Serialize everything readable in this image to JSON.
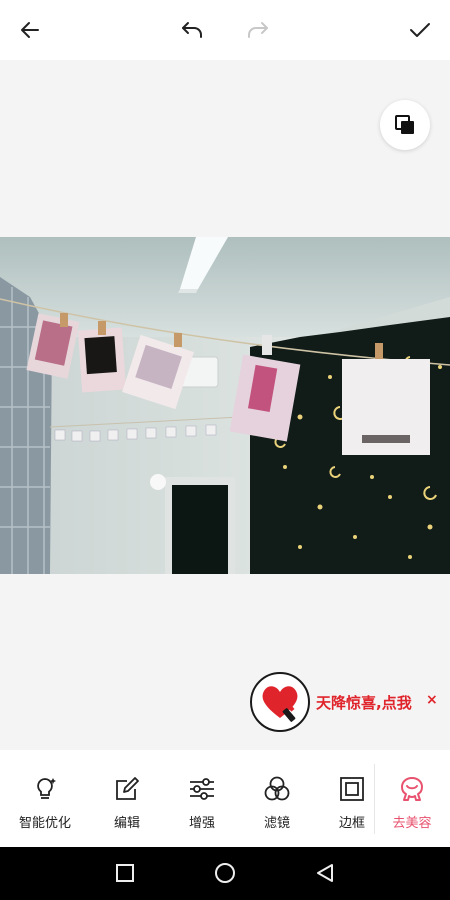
{
  "toolbar_top": {
    "back_icon": "arrow-left-icon",
    "undo_icon": "undo-icon",
    "redo_icon": "redo-icon",
    "done_icon": "check-icon"
  },
  "canvas": {
    "compare_icon": "compare-layers-icon"
  },
  "photo": {
    "note_text_1": "— — — —",
    "note_tag": "— —"
  },
  "promo": {
    "text": "天降惊喜,点我",
    "close": "×",
    "color": "#e0242b"
  },
  "tools": [
    {
      "label": "智能优化",
      "icon": "bulb-sparkle-icon"
    },
    {
      "label": "编辑",
      "icon": "edit-icon"
    },
    {
      "label": "增强",
      "icon": "sliders-icon"
    },
    {
      "label": "滤镜",
      "icon": "filter-circles-icon"
    },
    {
      "label": "边框",
      "icon": "frame-icon"
    },
    {
      "label": "去美容",
      "icon": "beauty-face-icon"
    }
  ],
  "accent_color": "#e8526e",
  "navbar": {
    "recent_icon": "recent-apps-icon",
    "home_icon": "home-circle-icon",
    "back_icon": "nav-back-triangle-icon"
  }
}
